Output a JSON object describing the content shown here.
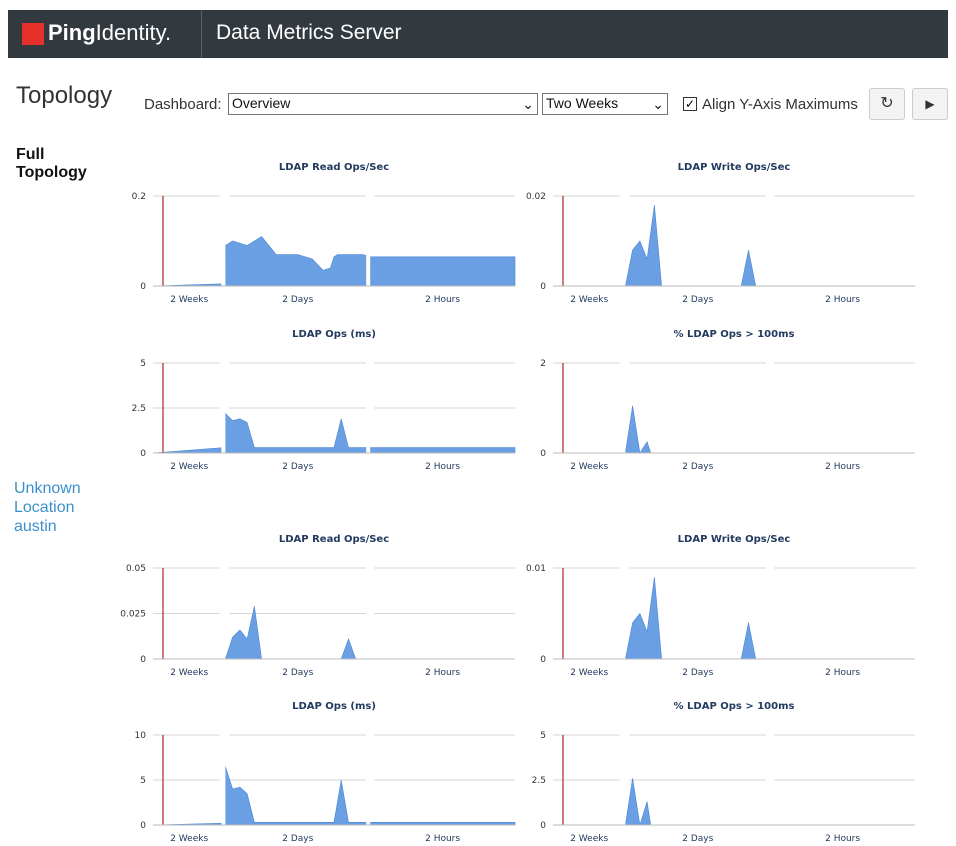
{
  "brand": {
    "bold": "Ping",
    "light": "Identity."
  },
  "app_title": "Data Metrics Server",
  "page_title": "Topology",
  "dashboard": {
    "label": "Dashboard:",
    "selected": "Overview"
  },
  "range": {
    "selected": "Two Weeks"
  },
  "align_checkbox": {
    "label": "Align Y-Axis Maximums",
    "checked": true
  },
  "buttons": {
    "refresh_icon": "refresh-icon",
    "play_icon": "play-icon"
  },
  "colors": {
    "fill": "#6a9fe4",
    "stroke": "#4a86d4",
    "marker": "#b22222",
    "grid": "#d6d6d6"
  },
  "groups": [
    {
      "title_line1": "Full",
      "title_line2": "Topology",
      "link": false
    },
    {
      "title_line1": "Unknown",
      "title_line2": "Location",
      "title_line3": "austin",
      "link": true
    }
  ],
  "chart_data": [
    {
      "group": "Full Topology",
      "type": "area",
      "title": "LDAP Read Ops/Sec",
      "y_ticks": [
        "0.2",
        "0"
      ],
      "ylim": [
        0,
        0.2
      ],
      "x_sections": [
        "2 Weeks",
        "2 Days",
        "2 Hours"
      ],
      "grid": true,
      "series": [
        {
          "values": [
            [
              0,
              0
            ],
            [
              0.98,
              0.005
            ],
            [
              1,
              0.09
            ],
            [
              1.1,
              0.1
            ],
            [
              1.3,
              0.09
            ],
            [
              1.5,
              0.11
            ],
            [
              1.7,
              0.07
            ],
            [
              2,
              0.07
            ],
            [
              2.2,
              0.06
            ],
            [
              2.35,
              0.035
            ],
            [
              2.45,
              0.04
            ],
            [
              2.5,
              0.065
            ],
            [
              2.55,
              0.07
            ],
            [
              2.9,
              0.07
            ],
            [
              3,
              0.065
            ],
            [
              4,
              0.065
            ],
            [
              5,
              0.065
            ]
          ]
        }
      ]
    },
    {
      "group": "Full Topology",
      "type": "area",
      "title": "LDAP Write Ops/Sec",
      "y_ticks": [
        "0.02",
        "0"
      ],
      "ylim": [
        0,
        0.02
      ],
      "x_sections": [
        "2 Weeks",
        "2 Days",
        "2 Hours"
      ],
      "grid": true,
      "series": [
        {
          "values": [
            [
              0,
              0
            ],
            [
              1,
              0
            ],
            [
              1.1,
              0.008
            ],
            [
              1.2,
              0.01
            ],
            [
              1.3,
              0.006
            ],
            [
              1.4,
              0.018
            ],
            [
              1.5,
              0
            ],
            [
              2.6,
              0
            ],
            [
              2.7,
              0.008
            ],
            [
              2.8,
              0
            ],
            [
              3,
              0
            ],
            [
              4,
              0
            ],
            [
              5,
              0
            ]
          ]
        }
      ]
    },
    {
      "group": "Full Topology",
      "type": "area",
      "title": "LDAP Ops (ms)",
      "y_ticks": [
        "5",
        "2.5",
        "0"
      ],
      "ylim": [
        0,
        5
      ],
      "x_sections": [
        "2 Weeks",
        "2 Days",
        "2 Hours"
      ],
      "grid": true,
      "series": [
        {
          "values": [
            [
              0,
              0
            ],
            [
              0.98,
              0.3
            ],
            [
              1,
              2.2
            ],
            [
              1.1,
              1.8
            ],
            [
              1.2,
              1.9
            ],
            [
              1.3,
              1.7
            ],
            [
              1.4,
              0.3
            ],
            [
              2.5,
              0.3
            ],
            [
              2.6,
              1.9
            ],
            [
              2.7,
              0.3
            ],
            [
              3,
              0.3
            ],
            [
              4,
              0.3
            ],
            [
              5,
              0.3
            ]
          ]
        }
      ]
    },
    {
      "group": "Full Topology",
      "type": "area",
      "title": "% LDAP Ops > 100ms",
      "y_ticks": [
        "2",
        "0"
      ],
      "ylim": [
        0,
        2
      ],
      "x_sections": [
        "2 Weeks",
        "2 Days",
        "2 Hours"
      ],
      "grid": true,
      "series": [
        {
          "values": [
            [
              0,
              0
            ],
            [
              1,
              0
            ],
            [
              1.1,
              1.05
            ],
            [
              1.2,
              0
            ],
            [
              1.3,
              0.25
            ],
            [
              1.35,
              0
            ],
            [
              3,
              0
            ],
            [
              5,
              0
            ]
          ]
        }
      ]
    },
    {
      "group": "Unknown Location austin",
      "type": "area",
      "title": "LDAP Read Ops/Sec",
      "y_ticks": [
        "0.05",
        "0.025",
        "0"
      ],
      "ylim": [
        0,
        0.05
      ],
      "x_sections": [
        "2 Weeks",
        "2 Days",
        "2 Hours"
      ],
      "grid": true,
      "series": [
        {
          "values": [
            [
              0,
              0
            ],
            [
              1,
              0
            ],
            [
              1.1,
              0.012
            ],
            [
              1.2,
              0.016
            ],
            [
              1.3,
              0.011
            ],
            [
              1.4,
              0.029
            ],
            [
              1.5,
              0
            ],
            [
              2.6,
              0
            ],
            [
              2.7,
              0.011
            ],
            [
              2.8,
              0
            ],
            [
              3,
              0
            ],
            [
              5,
              0
            ]
          ]
        }
      ]
    },
    {
      "group": "Unknown Location austin",
      "type": "area",
      "title": "LDAP Write Ops/Sec",
      "y_ticks": [
        "0.01",
        "0"
      ],
      "ylim": [
        0,
        0.01
      ],
      "x_sections": [
        "2 Weeks",
        "2 Days",
        "2 Hours"
      ],
      "grid": true,
      "series": [
        {
          "values": [
            [
              0,
              0
            ],
            [
              1,
              0
            ],
            [
              1.1,
              0.004
            ],
            [
              1.2,
              0.005
            ],
            [
              1.3,
              0.003
            ],
            [
              1.4,
              0.009
            ],
            [
              1.5,
              0
            ],
            [
              2.6,
              0
            ],
            [
              2.7,
              0.004
            ],
            [
              2.8,
              0
            ],
            [
              3,
              0
            ],
            [
              5,
              0
            ]
          ]
        }
      ]
    },
    {
      "group": "Unknown Location austin",
      "type": "area",
      "title": "LDAP Ops (ms)",
      "y_ticks": [
        "10",
        "5",
        "0"
      ],
      "ylim": [
        0,
        10
      ],
      "x_sections": [
        "2 Weeks",
        "2 Days",
        "2 Hours"
      ],
      "grid": true,
      "series": [
        {
          "values": [
            [
              0,
              0
            ],
            [
              0.98,
              0.2
            ],
            [
              1,
              6.5
            ],
            [
              1.1,
              4
            ],
            [
              1.2,
              4.2
            ],
            [
              1.3,
              3.5
            ],
            [
              1.4,
              0.3
            ],
            [
              2.5,
              0.3
            ],
            [
              2.6,
              5
            ],
            [
              2.7,
              0.3
            ],
            [
              3,
              0.3
            ],
            [
              4,
              0.3
            ],
            [
              5,
              0.3
            ]
          ]
        }
      ]
    },
    {
      "group": "Unknown Location austin",
      "type": "area",
      "title": "% LDAP Ops > 100ms",
      "y_ticks": [
        "5",
        "2.5",
        "0"
      ],
      "ylim": [
        0,
        5
      ],
      "x_sections": [
        "2 Weeks",
        "2 Days",
        "2 Hours"
      ],
      "grid": true,
      "series": [
        {
          "values": [
            [
              0,
              0
            ],
            [
              1,
              0
            ],
            [
              1.1,
              2.6
            ],
            [
              1.2,
              0
            ],
            [
              1.3,
              1.3
            ],
            [
              1.35,
              0
            ],
            [
              3,
              0
            ],
            [
              5,
              0
            ]
          ]
        }
      ]
    }
  ]
}
